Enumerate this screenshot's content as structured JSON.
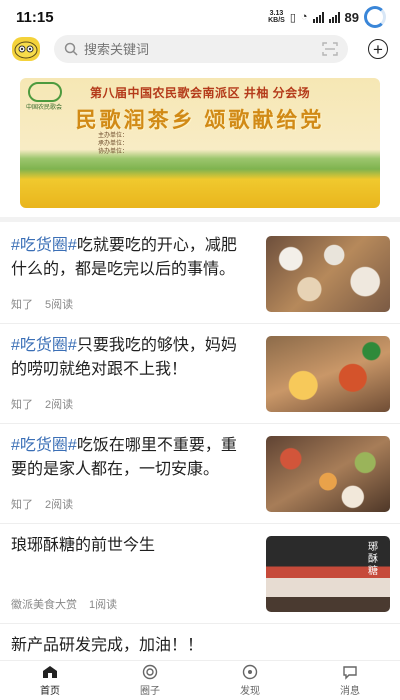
{
  "status": {
    "time": "11:15",
    "net_speed": "3.13",
    "net_unit": "KB/S",
    "battery": "89"
  },
  "header": {
    "search_placeholder": "搜索关键词",
    "add_icon": "plus-circle-icon"
  },
  "banner": {
    "org": "中国农民歌会",
    "subtitle": "第八届中国农民歌会南派区 井柚 分会场",
    "title": "民歌润茶乡 颂歌献给党",
    "info": [
      "主办单位：",
      "承办单位：",
      "协办单位："
    ]
  },
  "feed": [
    {
      "tag": "#吃货圈#",
      "text": "吃就要吃的开心，减肥什么的，都是吃完以后的事情。",
      "source": "知了",
      "reads": "5阅读",
      "image": "food-table-image"
    },
    {
      "tag": "#吃货圈#",
      "text": "只要我吃的够快，妈妈的唠叨就绝对跟不上我！",
      "source": "知了",
      "reads": "2阅读",
      "image": "barbecue-image"
    },
    {
      "tag": "#吃货圈#",
      "text": "吃饭在哪里不重要，重要的是家人都在，一切安康。",
      "source": "知了",
      "reads": "2阅读",
      "image": "family-dinner-image"
    },
    {
      "tag": "",
      "text": "琅琊酥糖的前世今生",
      "source": "徽派美食大赏",
      "reads": "1阅读",
      "image": "candy-product-image",
      "image_text": "琊酥糖"
    }
  ],
  "last_item": {
    "text": "新产品研发完成，加油！！"
  },
  "tabs": [
    {
      "label": "首页",
      "icon": "home-icon"
    },
    {
      "label": "圈子",
      "icon": "circle-icon"
    },
    {
      "label": "发现",
      "icon": "eye-icon"
    },
    {
      "label": "消息",
      "icon": "message-icon"
    }
  ]
}
